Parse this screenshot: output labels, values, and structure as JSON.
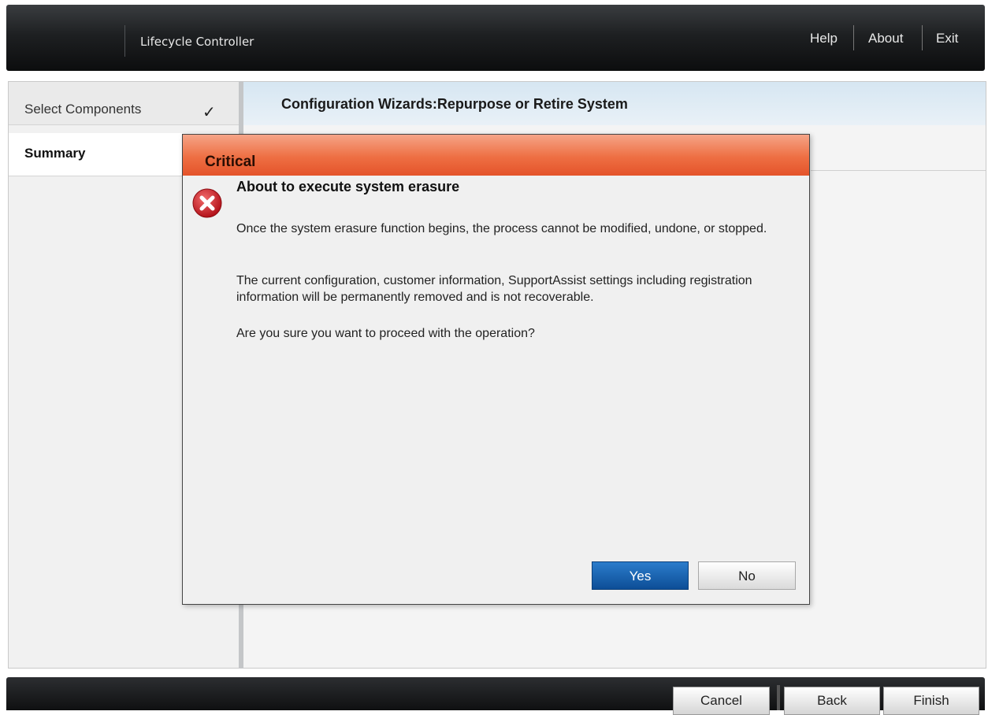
{
  "header": {
    "app_title": "Lifecycle Controller",
    "links": {
      "help": "Help",
      "about": "About",
      "exit": "Exit"
    }
  },
  "sidebar": {
    "items": [
      {
        "label": "Select Components",
        "completed": true
      },
      {
        "label": "Summary",
        "active": true
      }
    ]
  },
  "main": {
    "title": "Configuration Wizards:Repurpose or Retire System"
  },
  "modal": {
    "severity": "Critical",
    "icon": "error-icon",
    "heading": "About to execute system erasure",
    "paragraphs": [
      "Once the system erasure function begins, the process cannot be modified, undone, or stopped.",
      "The current configuration, customer information, SupportAssist settings including registration information will be permanently removed and is not recoverable.",
      "Are you sure you want to proceed with the operation?"
    ],
    "yes_label": "Yes",
    "no_label": "No"
  },
  "footer": {
    "cancel_label": "Cancel",
    "back_label": "Back",
    "finish_label": "Finish"
  },
  "colors": {
    "header_bg": "#1e2022",
    "critical_header": "#ee6f43",
    "primary_button": "#0d4e97",
    "wizard_header": "#d6e6f2"
  }
}
